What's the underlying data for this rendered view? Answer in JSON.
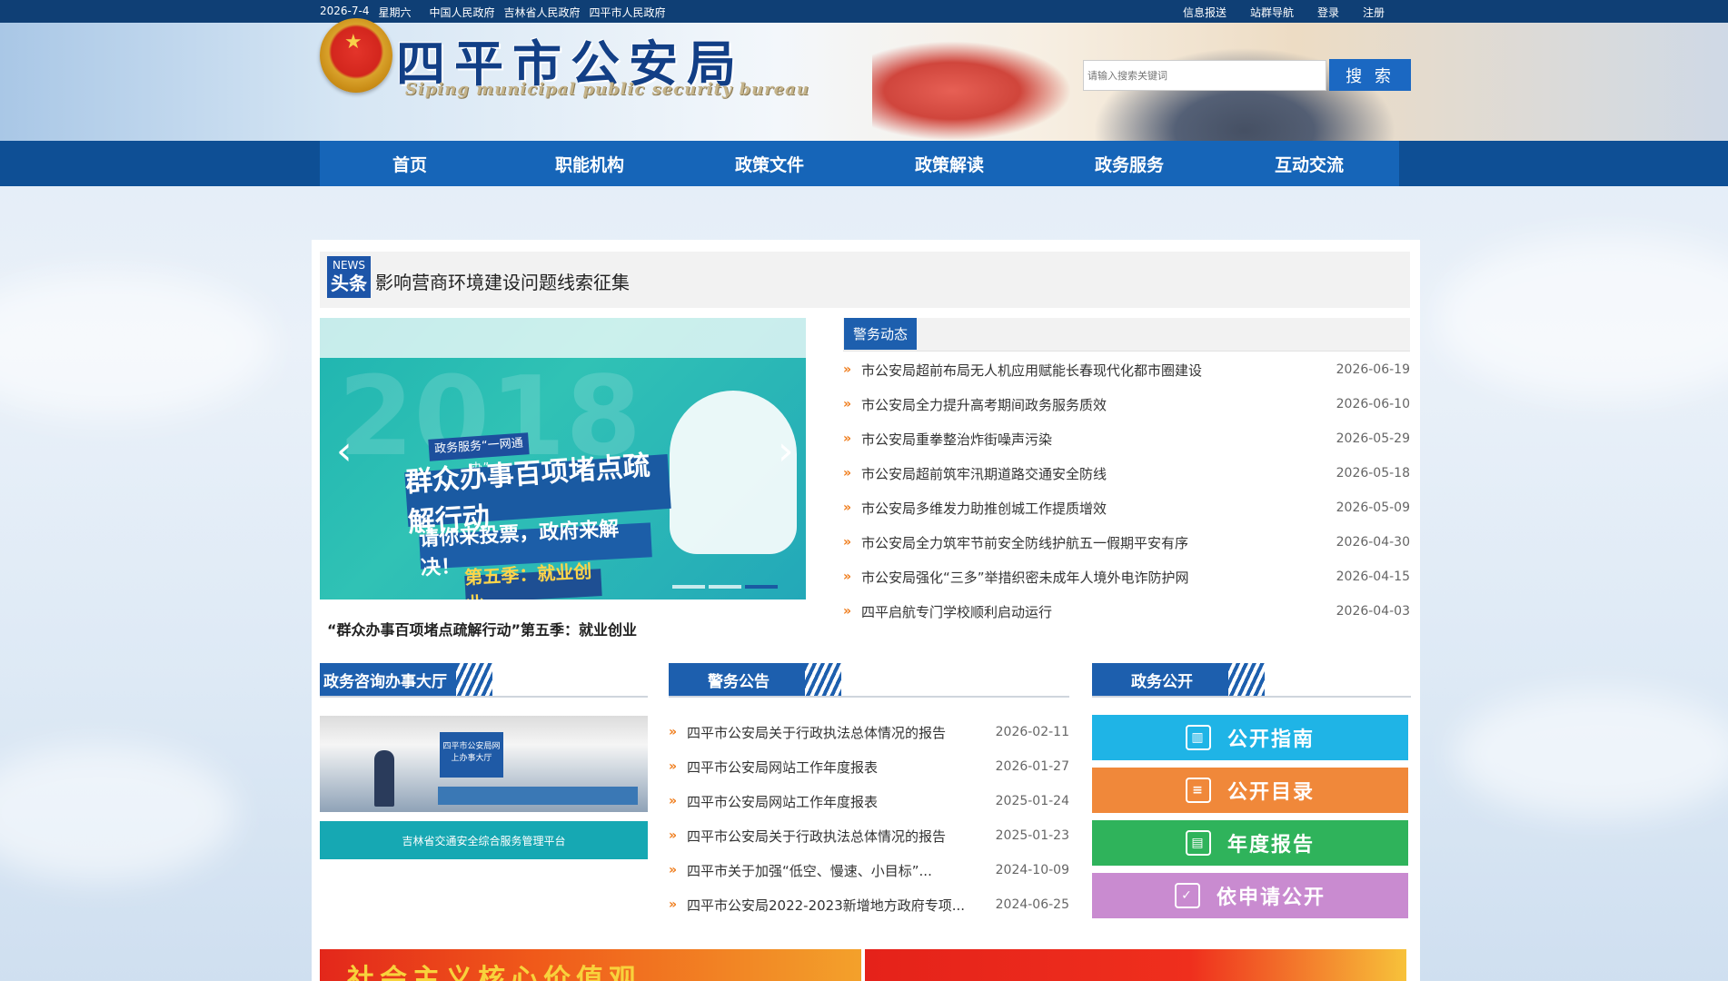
{
  "topbar": {
    "date": "2026-7-4",
    "weekday": "星期六",
    "links": [
      "中国人民政府",
      "吉林省人民政府",
      "四平市人民政府"
    ],
    "right_links": [
      "信息报送",
      "站群导航",
      "登录",
      "注册"
    ]
  },
  "header": {
    "title": "四平市公安局",
    "subtitle": "Siping municipal public security bureau",
    "search_placeholder": "请输入搜索关键词",
    "search_button": "搜 索"
  },
  "nav": [
    "首页",
    "职能机构",
    "政策文件",
    "政策解读",
    "政务服务",
    "互动交流"
  ],
  "headline": {
    "badge_en": "NEWS",
    "badge_cn": "头条",
    "text": "影响营商环境建设问题线索征集"
  },
  "carousel": {
    "slide_tag": "政务服务“一网通办”",
    "slide_big": "群众办事百项堵点疏解行动",
    "slide_mid": "请你来投票，政府来解决！",
    "slide_small": "第五季：就业创业",
    "caption": "“群众办事百项堵点疏解行动”第五季：就业创业",
    "prev": "‹",
    "next": "›"
  },
  "police_news": {
    "tab": "警务动态",
    "items": [
      {
        "title": "市公安局超前布局无人机应用赋能长春现代化都市圈建设",
        "date": "2026-06-19"
      },
      {
        "title": "市公安局全力提升高考期间政务服务质效",
        "date": "2026-06-10"
      },
      {
        "title": "市公安局重拳整治炸街噪声污染",
        "date": "2026-05-29"
      },
      {
        "title": "市公安局超前筑牢汛期道路交通安全防线",
        "date": "2026-05-18"
      },
      {
        "title": "市公安局多维发力助推创城工作提质增效",
        "date": "2026-05-09"
      },
      {
        "title": "市公安局全力筑牢节前安全防线护航五一假期平安有序",
        "date": "2026-04-30"
      },
      {
        "title": "市公安局强化“三多”举措织密未成年人境外电诈防护网",
        "date": "2026-04-15"
      },
      {
        "title": "四平启航专门学校顺利启动运行",
        "date": "2026-04-03"
      }
    ]
  },
  "office_hall": {
    "title": "政务咨询办事大厅",
    "sign_text": "四平市公安局网上办事大厅",
    "link": "吉林省交通安全综合服务管理平台"
  },
  "announcements": {
    "title": "警务公告",
    "items": [
      {
        "title": "四平市公安局关于行政执法总体情况的报告",
        "date": "2026-02-11"
      },
      {
        "title": "四平市公安局网站工作年度报表",
        "date": "2026-01-27"
      },
      {
        "title": "四平市公安局网站工作年度报表",
        "date": "2025-01-24"
      },
      {
        "title": "四平市公安局关于行政执法总体情况的报告",
        "date": "2025-01-23"
      },
      {
        "title": "四平市关于加强“低空、慢速、小目标”...",
        "date": "2024-10-09"
      },
      {
        "title": "四平市公安局2022-2023新增地方政府专项...",
        "date": "2024-06-25"
      }
    ]
  },
  "gov_open": {
    "title": "政务公开",
    "buttons": [
      {
        "label": "公开指南",
        "color": "#1fb4e6",
        "icon": "book-icon"
      },
      {
        "label": "公开目录",
        "color": "#f0883a",
        "icon": "list-icon"
      },
      {
        "label": "年度报告",
        "color": "#2fb35b",
        "icon": "chart-icon"
      },
      {
        "label": "依申请公开",
        "color": "#c98bd0",
        "icon": "document-icon"
      }
    ]
  },
  "banners": {
    "left": "社会主义核心价值观"
  },
  "colors": {
    "topbar": "#0f3f75",
    "nav": "#1665b8",
    "accent": "#1d5fae",
    "bullet": "#ef7d1d"
  }
}
